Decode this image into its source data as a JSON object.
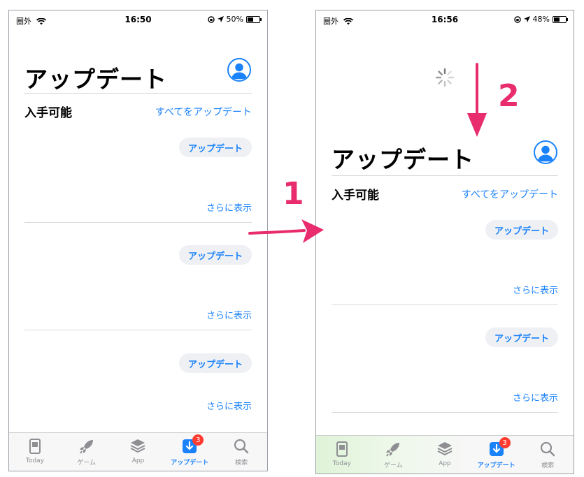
{
  "colors": {
    "accent": "#1a82fb",
    "annotation": "#e82c6e",
    "badge": "#ff3b30"
  },
  "screens": [
    {
      "status": {
        "carrier": "圏外",
        "time": "16:50",
        "battery": "50%",
        "battery_level": 0.5
      },
      "title": "アップデート",
      "section": "入手可能",
      "update_all": "すべてをアップデート",
      "items": [
        {
          "button": "アップデート",
          "more": "さらに表示"
        },
        {
          "button": "アップデート",
          "more": "さらに表示"
        },
        {
          "button": "アップデート",
          "more": "さらに表示"
        }
      ]
    },
    {
      "status": {
        "carrier": "圏外",
        "time": "16:56",
        "battery": "48%",
        "battery_level": 0.48
      },
      "title": "アップデート",
      "section": "入手可能",
      "update_all": "すべてをアップデート",
      "items": [
        {
          "button": "アップデート",
          "more": "さらに表示"
        },
        {
          "button": "アップデート",
          "more": "さらに表示"
        }
      ]
    }
  ],
  "tabbar": {
    "tabs": [
      {
        "label": "Today",
        "icon": "today-icon"
      },
      {
        "label": "ゲーム",
        "icon": "rocket-icon"
      },
      {
        "label": "App",
        "icon": "layers-icon"
      },
      {
        "label": "アップデート",
        "icon": "download-icon",
        "badge": "3",
        "active": true
      },
      {
        "label": "検索",
        "icon": "search-icon"
      }
    ]
  },
  "annotations": {
    "step1": "1",
    "step2": "2"
  }
}
